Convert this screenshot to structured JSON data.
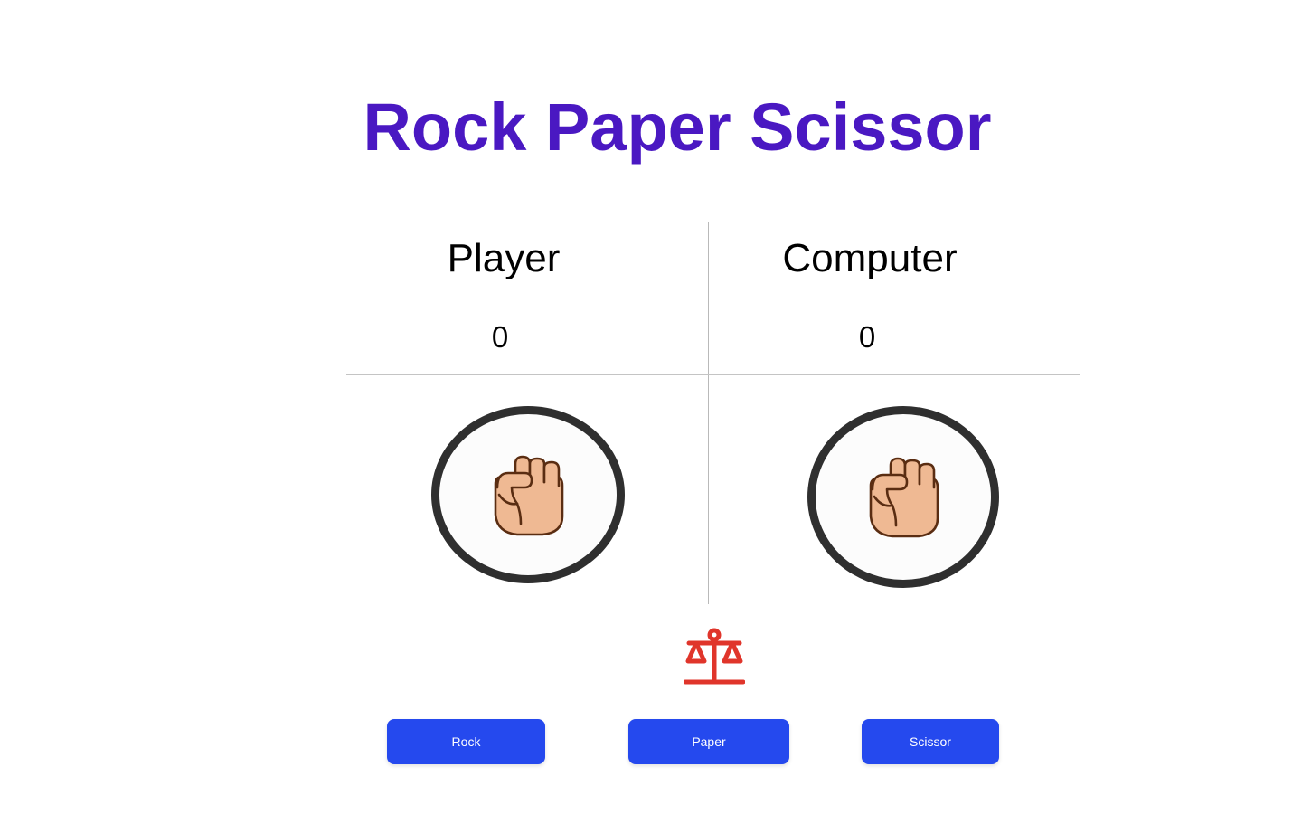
{
  "title": "Rock Paper Scissor",
  "scoreboard": {
    "player_label": "Player",
    "computer_label": "Computer",
    "player_score": "0",
    "computer_score": "0"
  },
  "hands": {
    "player_choice_icon": "rock-fist-icon",
    "computer_choice_icon": "rock-fist-icon"
  },
  "result": {
    "icon": "balance-scale-icon",
    "color": "#e0352b"
  },
  "buttons": {
    "rock_label": "Rock",
    "paper_label": "Paper",
    "scissor_label": "Scissor"
  },
  "colors": {
    "title": "#4a18c2",
    "button": "#2549ee",
    "circle_border": "#2f2f2f",
    "skin": "#efb993",
    "skin_outline": "#5a2d12"
  }
}
